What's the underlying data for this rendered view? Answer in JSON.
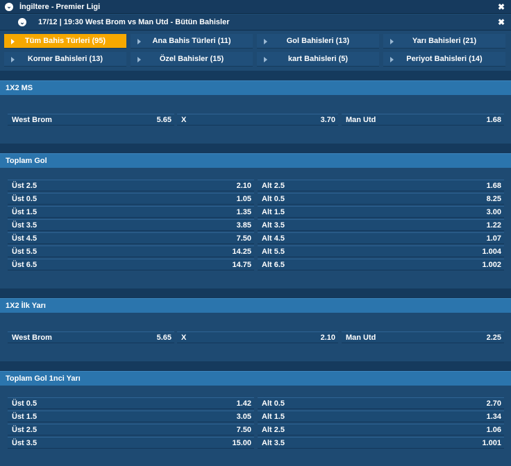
{
  "league": {
    "title": "İngiltere - Premier Ligi",
    "collapse_icon": "chevron-down-icon",
    "close_icon": "close-icon"
  },
  "match": {
    "title": "17/12 | 19:30 West Brom vs Man Utd - Bütün Bahisler",
    "collapse_icon": "chevron-down-icon",
    "close_icon": "close-icon"
  },
  "colors": {
    "accent_active_tab": "#f6a800",
    "section_header": "#2b75ad",
    "background": "#1e4a72"
  },
  "tabs": [
    {
      "label": "Tüm Bahis Türleri (95)",
      "active": true
    },
    {
      "label": "Ana Bahis Türleri (11)",
      "active": false
    },
    {
      "label": "Gol Bahisleri (13)",
      "active": false
    },
    {
      "label": "Yarı Bahisleri (21)",
      "active": false
    },
    {
      "label": "Korner Bahisleri (13)",
      "active": false
    },
    {
      "label": "Özel Bahisler (15)",
      "active": false
    },
    {
      "label": "kart Bahisleri (5)",
      "active": false
    },
    {
      "label": "Periyot Bahisleri (14)",
      "active": false
    }
  ],
  "sections": {
    "ms": {
      "title": "1X2 MS",
      "outcomes": [
        {
          "label": "West Brom",
          "odd": "5.65"
        },
        {
          "label": "X",
          "odd": "3.70"
        },
        {
          "label": "Man Utd",
          "odd": "1.68"
        }
      ]
    },
    "total_goals": {
      "title": "Toplam Gol",
      "rows": [
        {
          "over_label": "Üst 2.5",
          "over_odd": "2.10",
          "under_label": "Alt 2.5",
          "under_odd": "1.68"
        },
        {
          "over_label": "Üst 0.5",
          "over_odd": "1.05",
          "under_label": "Alt 0.5",
          "under_odd": "8.25"
        },
        {
          "over_label": "Üst 1.5",
          "over_odd": "1.35",
          "under_label": "Alt 1.5",
          "under_odd": "3.00"
        },
        {
          "over_label": "Üst 3.5",
          "over_odd": "3.85",
          "under_label": "Alt 3.5",
          "under_odd": "1.22"
        },
        {
          "over_label": "Üst 4.5",
          "over_odd": "7.50",
          "under_label": "Alt 4.5",
          "under_odd": "1.07"
        },
        {
          "over_label": "Üst 5.5",
          "over_odd": "14.25",
          "under_label": "Alt 5.5",
          "under_odd": "1.004"
        },
        {
          "over_label": "Üst 6.5",
          "over_odd": "14.75",
          "under_label": "Alt 6.5",
          "under_odd": "1.002"
        }
      ]
    },
    "first_half": {
      "title": "1X2 İlk Yarı",
      "outcomes": [
        {
          "label": "West Brom",
          "odd": "5.65"
        },
        {
          "label": "X",
          "odd": "2.10"
        },
        {
          "label": "Man Utd",
          "odd": "2.25"
        }
      ]
    },
    "first_half_goals": {
      "title": "Toplam Gol 1nci Yarı",
      "rows": [
        {
          "over_label": "Üst 0.5",
          "over_odd": "1.42",
          "under_label": "Alt 0.5",
          "under_odd": "2.70"
        },
        {
          "over_label": "Üst 1.5",
          "over_odd": "3.05",
          "under_label": "Alt 1.5",
          "under_odd": "1.34"
        },
        {
          "over_label": "Üst 2.5",
          "over_odd": "7.50",
          "under_label": "Alt 2.5",
          "under_odd": "1.06"
        },
        {
          "over_label": "Üst 3.5",
          "over_odd": "15.00",
          "under_label": "Alt 3.5",
          "under_odd": "1.001"
        }
      ]
    }
  }
}
